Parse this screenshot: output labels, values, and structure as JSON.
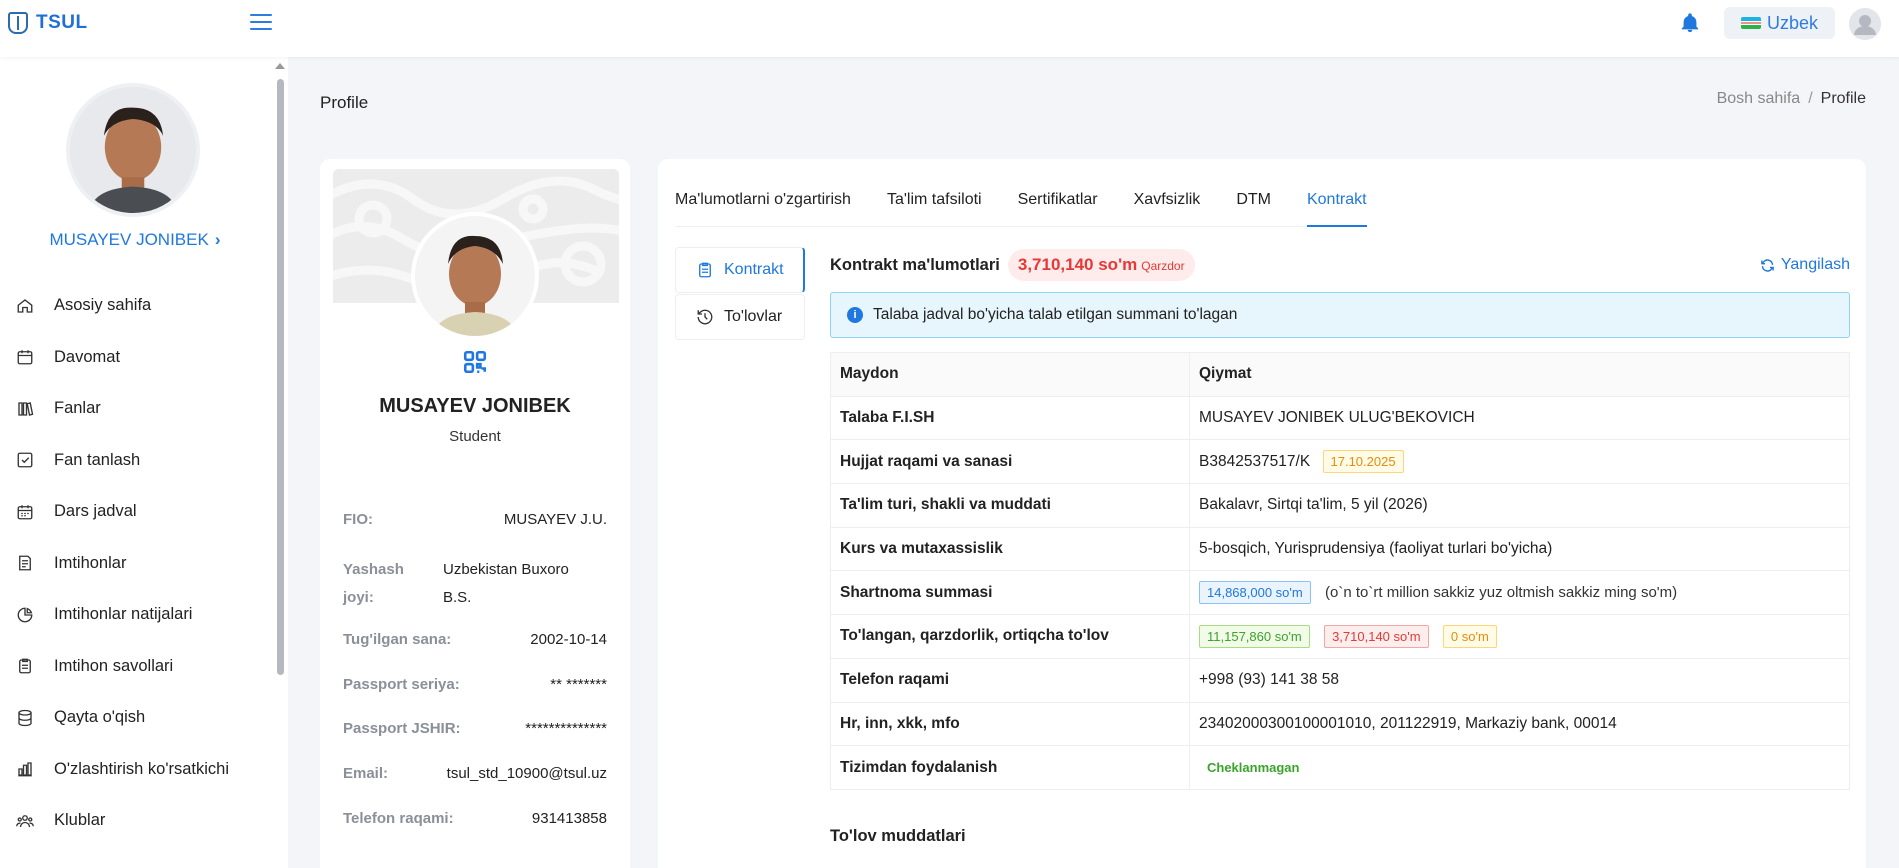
{
  "header": {
    "logo_text": "TSUL",
    "language": "Uzbek"
  },
  "sidebar": {
    "user_name": "MUSAYEV JONIBEK",
    "chevron": "›",
    "items": [
      {
        "label": "Asosiy sahifa",
        "icon": "home-icon"
      },
      {
        "label": "Davomat",
        "icon": "calendar-icon"
      },
      {
        "label": "Fanlar",
        "icon": "books-icon"
      },
      {
        "label": "Fan tanlash",
        "icon": "checkbox-icon"
      },
      {
        "label": "Dars jadval",
        "icon": "schedule-icon"
      },
      {
        "label": "Imtihonlar",
        "icon": "exam-icon"
      },
      {
        "label": "Imtihonlar natijalari",
        "icon": "results-icon"
      },
      {
        "label": "Imtihon savollari",
        "icon": "clipboard-icon"
      },
      {
        "label": "Qayta o'qish",
        "icon": "database-icon"
      },
      {
        "label": "O'zlashtirish ko'rsatkichi",
        "icon": "bar-chart-icon"
      },
      {
        "label": "Klublar",
        "icon": "group-icon"
      }
    ]
  },
  "page": {
    "title": "Profile",
    "breadcrumb": {
      "home": "Bosh sahifa",
      "separator": "/",
      "current": "Profile"
    }
  },
  "profile_card": {
    "name": "MUSAYEV JONIBEK",
    "role": "Student",
    "fields": [
      {
        "label": "FIO:",
        "value": "MUSAYEV J.U."
      },
      {
        "label": "Yashash joyi:",
        "value": "Uzbekistan Buxoro B.S."
      },
      {
        "label": "Tug'ilgan sana:",
        "value": "2002-10-14"
      },
      {
        "label": "Passport seriya:",
        "value": "** *******"
      },
      {
        "label": "Passport JSHIR:",
        "value": "**************"
      },
      {
        "label": "Email:",
        "value": "tsul_std_10900@tsul.uz"
      },
      {
        "label": "Telefon raqami:",
        "value": "931413858"
      }
    ]
  },
  "tabs": [
    "Ma'lumotlarni o'zgartirish",
    "Ta'lim tafsiloti",
    "Sertifikatlar",
    "Xavfsizlik",
    "DTM",
    "Kontrakt"
  ],
  "active_tab": "Kontrakt",
  "vertical_tabs": [
    {
      "label": "Kontrakt",
      "icon": "clipboard-icon"
    },
    {
      "label": "To'lovlar",
      "icon": "history-icon"
    }
  ],
  "contract": {
    "title": "Kontrakt ma'lumotlari",
    "debt_amount": "3,710,140 so'm",
    "debt_status": "Qarzdor",
    "refresh_label": "Yangilash",
    "alert_text": "Talaba jadval bo'yicha talab etilgan summani to'lagan",
    "table_headers": [
      "Maydon",
      "Qiymat"
    ],
    "rows": {
      "fish": {
        "label": "Talaba F.I.SH",
        "value": "MUSAYEV JONIBEK ULUG'BEKOVICH"
      },
      "doc": {
        "label": "Hujjat raqami va sanasi",
        "value": "B3842537517/K",
        "date": "17.10.2025"
      },
      "edu": {
        "label": "Ta'lim turi, shakli va muddati",
        "value": "Bakalavr, Sirtqi ta'lim, 5 yil (2026)"
      },
      "course": {
        "label": "Kurs va mutaxassislik",
        "value": "5-bosqich, Yurisprudensiya (faoliyat turlari bo'yicha)"
      },
      "sum": {
        "label": "Shartnoma summasi",
        "amount": "14,868,000 so'm",
        "words": "(o`n to`rt million sakkiz yuz oltmish sakkiz ming so'm)"
      },
      "paid": {
        "label": "To'langan, qarzdorlik, ortiqcha to'lov",
        "paid": "11,157,860 so'm",
        "debt": "3,710,140 so'm",
        "over": "0 so'm"
      },
      "phone": {
        "label": "Telefon raqami",
        "value": "+998 (93) 141 38 58"
      },
      "bank": {
        "label": "Hr, inn, xkk, mfo",
        "value": "23402000300100001010, 201122919, Markaziy bank, 00014"
      },
      "usage": {
        "label": "Tizimdan foydalanish",
        "value": "Cheklanmagan"
      }
    },
    "payment_deadlines_title": "To'lov muddatlari"
  },
  "colors": {
    "accent": "#1f78e0",
    "danger": "#e53935",
    "success": "#3aa42b",
    "warning": "#e88c0a"
  }
}
